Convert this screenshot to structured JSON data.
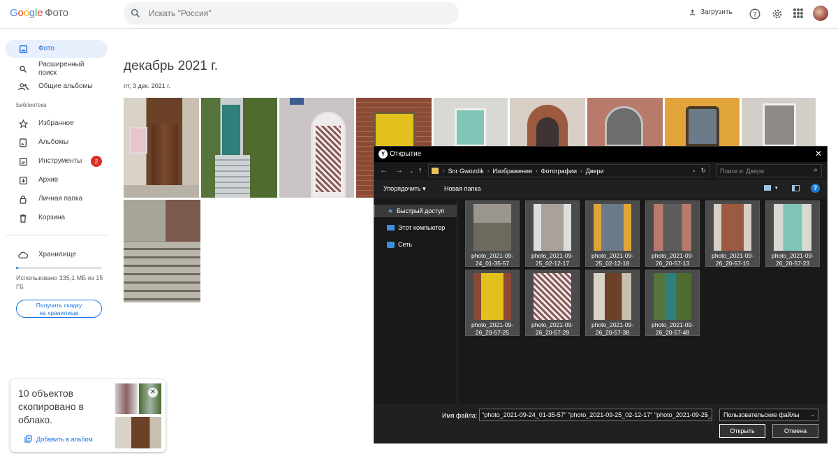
{
  "header": {
    "logo_google": "Google",
    "logo_product": "Фото",
    "search_placeholder": "Искать \"Россия\"",
    "upload_label": "Загрузить"
  },
  "sidebar": {
    "items": [
      {
        "label": "Фото",
        "icon": "photo-icon",
        "active": true
      },
      {
        "label": "Расширенный поиск",
        "icon": "search-icon"
      },
      {
        "label": "Общие альбомы",
        "icon": "people-icon"
      }
    ],
    "library_label": "Библиотека",
    "library": [
      {
        "label": "Избранное",
        "icon": "star-icon"
      },
      {
        "label": "Альбомы",
        "icon": "album-icon"
      },
      {
        "label": "Инструменты",
        "icon": "tools-icon",
        "badge": "2"
      },
      {
        "label": "Архив",
        "icon": "archive-icon"
      },
      {
        "label": "Личная папка",
        "icon": "lock-icon"
      },
      {
        "label": "Корзина",
        "icon": "trash-icon"
      }
    ],
    "storage_label": "Хранилище",
    "storage_used_text": "Использовано 335,1 МБ из 15 ГБ",
    "storage_fraction": 0.022,
    "upgrade_line1": "Получить скидку",
    "upgrade_line2": "на хранилище"
  },
  "main": {
    "title": "декабрь 2021 г.",
    "date": "пт, 3 дек. 2021 г."
  },
  "toast": {
    "message": "10 объектов скопировано в облако.",
    "action": "Добавить в альбом"
  },
  "dialog": {
    "title": "Открытие",
    "breadcrumb": [
      "Snr Gwozdik",
      "Изображения",
      "Фотографии",
      "Двери"
    ],
    "search_placeholder": "Поиск в: Двери",
    "organize": "Упорядочить",
    "new_folder": "Новая папка",
    "tree": [
      {
        "label": "Быстрый доступ",
        "icon": "star-icon",
        "selected": true
      },
      {
        "label": "Этот компьютер",
        "icon": "computer-icon"
      },
      {
        "label": "Сеть",
        "icon": "network-icon"
      }
    ],
    "files": [
      {
        "name": "photo_2021-09-24_01-35-57"
      },
      {
        "name": "photo_2021-09-25_02-12-17"
      },
      {
        "name": "photo_2021-09-25_02-12-18"
      },
      {
        "name": "photo_2021-09-26_20-57-13"
      },
      {
        "name": "photo_2021-09-26_20-57-15"
      },
      {
        "name": "photo_2021-09-26_20-57-23"
      },
      {
        "name": "photo_2021-09-26_20-57-25"
      },
      {
        "name": "photo_2021-09-26_20-57-29"
      },
      {
        "name": "photo_2021-09-26_20-57-38"
      },
      {
        "name": "photo_2021-09-26_20-57-48"
      }
    ],
    "filename_label": "Имя файла:",
    "filename_value": "\"photo_2021-09-24_01-35-57\" \"photo_2021-09-25_02-12-17\" \"photo_2021-09-25_0",
    "filetype": "Пользовательские файлы",
    "open_button": "Открыть",
    "cancel_button": "Отмена"
  },
  "colors": {
    "accent": "#1a73e8",
    "active_bg": "#e8f0fe",
    "badge": "#d93025",
    "dialog_bg": "#202020"
  }
}
